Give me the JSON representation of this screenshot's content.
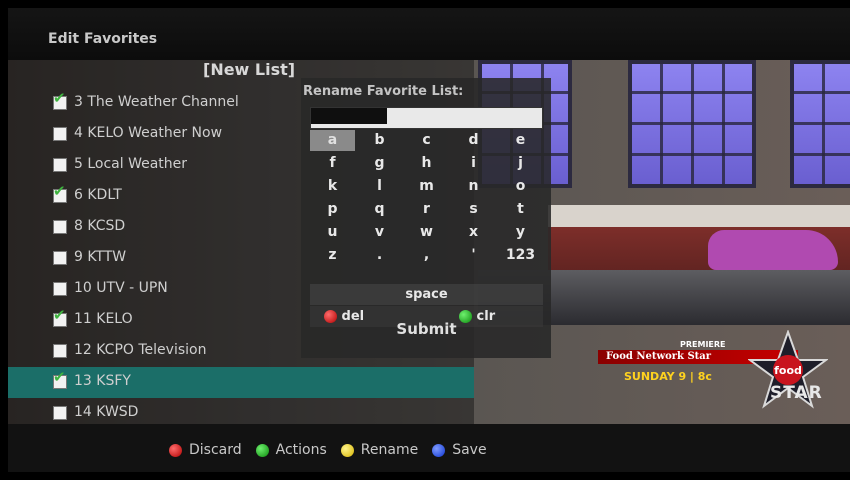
{
  "screen": {
    "title": "Edit Favorites"
  },
  "list": {
    "title": "[New List]",
    "channels": [
      {
        "label": "3 The Weather Channel",
        "checked": true
      },
      {
        "label": "4 KELO Weather Now",
        "checked": false
      },
      {
        "label": "5 Local Weather",
        "checked": false
      },
      {
        "label": "6 KDLT",
        "checked": true
      },
      {
        "label": "8 KCSD",
        "checked": false
      },
      {
        "label": "9 KTTW",
        "checked": false
      },
      {
        "label": "10 UTV - UPN",
        "checked": false
      },
      {
        "label": "11 KELO",
        "checked": true
      },
      {
        "label": "12 KCPO Television",
        "checked": false
      },
      {
        "label": "13 KSFY",
        "checked": true,
        "selected": true
      },
      {
        "label": "14 KWSD",
        "checked": false
      }
    ]
  },
  "keyboard": {
    "title": "Rename Favorite List:",
    "input_value": "",
    "keys": [
      [
        "a",
        "b",
        "c",
        "d",
        "e"
      ],
      [
        "f",
        "g",
        "h",
        "i",
        "j"
      ],
      [
        "k",
        "l",
        "m",
        "n",
        "o"
      ],
      [
        "p",
        "q",
        "r",
        "s",
        "t"
      ],
      [
        "u",
        "v",
        "w",
        "x",
        "y"
      ],
      [
        "z",
        ".",
        ",",
        "'",
        "123"
      ]
    ],
    "selected_key": "a",
    "space_label": "space",
    "del_label": "del",
    "clr_label": "clr",
    "submit_label": "Submit"
  },
  "promo": {
    "premiere": "PREMIERE",
    "show": "Food Network Star",
    "time": "SUNDAY 9 | 8c",
    "logo_word": "food",
    "star_word": "STAR"
  },
  "footer": {
    "discard": "Discard",
    "actions": "Actions",
    "rename": "Rename",
    "save": "Save"
  },
  "colors": {
    "selected_row": "#1b6e68",
    "red": "#c00000",
    "green": "#11a011",
    "yellow": "#e6c800",
    "blue": "#1a44e0"
  }
}
